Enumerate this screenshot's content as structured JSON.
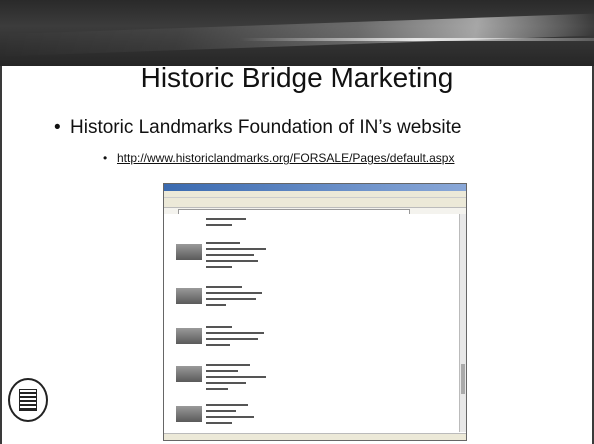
{
  "slide": {
    "title": "Historic Bridge Marketing",
    "bullets": [
      {
        "text": "Historic Landmarks Foundation of IN’s website",
        "sub": [
          {
            "text": "http://www.historiclandmarks.org/FORSALE/Pages/default.aspx"
          }
        ]
      }
    ],
    "bullet_glyph": "•"
  },
  "screenshot": {
    "description_icon": "browser-window-screenshot"
  },
  "seal": {
    "icon": "organization-seal-icon"
  },
  "colors": {
    "header_band": "#2f2f2f",
    "text": "#111111",
    "background": "#ffffff"
  }
}
